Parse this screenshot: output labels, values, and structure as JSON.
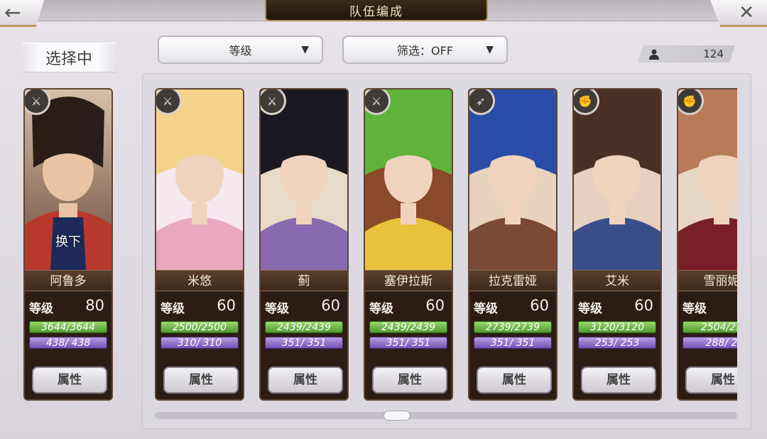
{
  "header": {
    "title": "队伍编成",
    "back_icon": "←",
    "close_icon": "✕"
  },
  "selecting_label": "选择中",
  "sort_dropdown": {
    "value": "等级"
  },
  "filter_dropdown": {
    "value": "筛选：OFF"
  },
  "unit_count": {
    "icon": "person-icon",
    "value": "124"
  },
  "selected_card": {
    "name": "阿鲁多",
    "level_label": "等级",
    "level": "80",
    "hp": "3644/3644",
    "mp": "438/ 438",
    "attr_label": "属性",
    "swap_label": "换下",
    "weapon": "sword",
    "portrait_colors": [
      "#3a2a22",
      "#c04a3a",
      "#1b1c2a"
    ]
  },
  "cards": [
    {
      "name": "米悠",
      "level_label": "等级",
      "level": "60",
      "hp": "2500/2500",
      "mp": "310/ 310",
      "attr_label": "属性",
      "weapon": "sword",
      "portrait_colors": [
        "#f3d38a",
        "#e9a8c0",
        "#f7e7ef"
      ]
    },
    {
      "name": "蓟",
      "level_label": "等级",
      "level": "60",
      "hp": "2439/2439",
      "mp": "351/ 351",
      "attr_label": "属性",
      "weapon": "sword",
      "portrait_colors": [
        "#1a1820",
        "#8a6ab0",
        "#e8dcc8"
      ]
    },
    {
      "name": "塞伊拉斯",
      "level_label": "等级",
      "level": "60",
      "hp": "2439/2439",
      "mp": "351/ 351",
      "attr_label": "属性",
      "weapon": "sword",
      "portrait_colors": [
        "#5fb33a",
        "#e8c23a",
        "#8a4a2a"
      ]
    },
    {
      "name": "拉克雷娅",
      "level_label": "等级",
      "level": "60",
      "hp": "2739/2739",
      "mp": "351/ 351",
      "attr_label": "属性",
      "weapon": "bow",
      "portrait_colors": [
        "#2a4ea8",
        "#7a4a34",
        "#e9d2bd"
      ]
    },
    {
      "name": "艾米",
      "level_label": "等级",
      "level": "60",
      "hp": "3120/3120",
      "mp": "253/ 253",
      "attr_label": "属性",
      "weapon": "fist",
      "portrait_colors": [
        "#4a2f24",
        "#3a4f8a",
        "#e8d0c0"
      ]
    },
    {
      "name": "雪丽妮",
      "level_label": "等级",
      "level": "60",
      "hp": "2504/25",
      "mp": "288/ 2",
      "attr_label": "属性",
      "weapon": "fist",
      "portrait_colors": [
        "#b97a5a",
        "#7a1f28",
        "#e8d6c4"
      ]
    }
  ]
}
